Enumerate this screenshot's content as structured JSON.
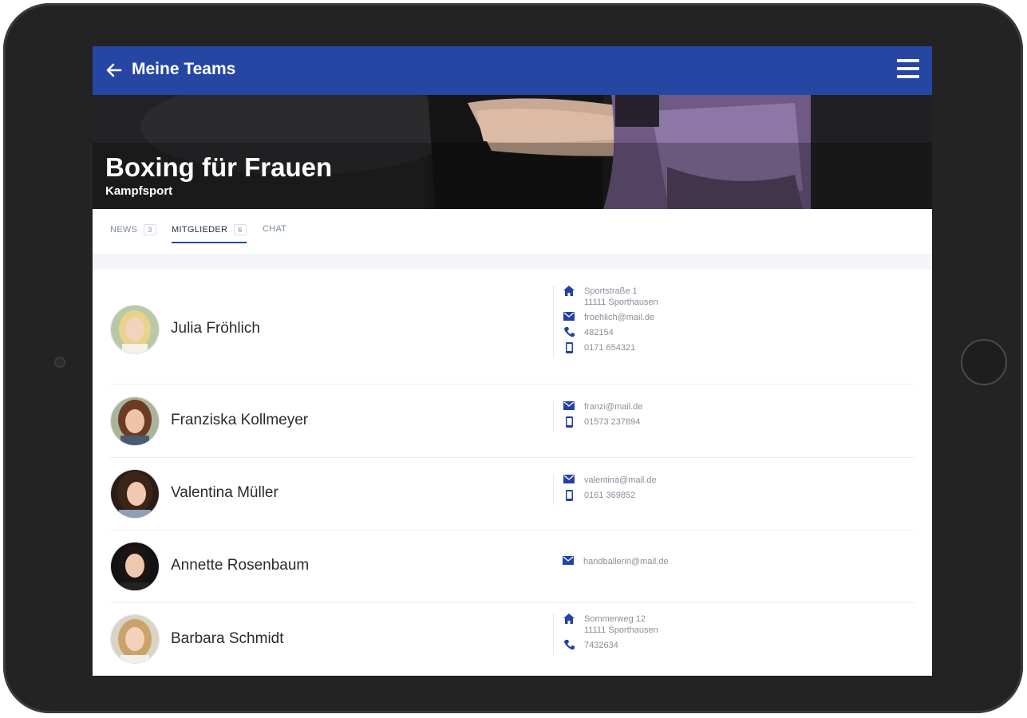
{
  "appbar": {
    "title": "Meine Teams",
    "back_icon": "arrow-left-icon",
    "menu_icon": "hamburger-menu-icon",
    "color": "#2646a3"
  },
  "hero": {
    "title": "Boxing für Frauen",
    "subtitle": "Kampfsport"
  },
  "tabs": [
    {
      "label": "NEWS",
      "count": "3",
      "active": false
    },
    {
      "label": "MITGLIEDER",
      "count": "6",
      "active": true
    },
    {
      "label": "CHAT",
      "count": "",
      "active": false
    }
  ],
  "members": [
    {
      "name": "Julia Fröhlich",
      "contacts": [
        {
          "icon": "home-icon",
          "lines": [
            "Sportstraße 1",
            "11111 Sporthausen"
          ]
        },
        {
          "icon": "mail-icon",
          "lines": [
            "froehlich@mail.de"
          ]
        },
        {
          "icon": "phone-icon",
          "lines": [
            "482154"
          ]
        },
        {
          "icon": "mobile-icon",
          "lines": [
            "0171 654321"
          ]
        }
      ]
    },
    {
      "name": "Franziska Kollmeyer",
      "contacts": [
        {
          "icon": "mail-icon",
          "lines": [
            "franzi@mail.de"
          ]
        },
        {
          "icon": "mobile-icon",
          "lines": [
            "01573 237894"
          ]
        }
      ]
    },
    {
      "name": "Valentina Müller",
      "contacts": [
        {
          "icon": "mail-icon",
          "lines": [
            "valentina@mail.de"
          ]
        },
        {
          "icon": "mobile-icon",
          "lines": [
            "0161 369852"
          ]
        }
      ]
    },
    {
      "name": "Annette Rosenbaum",
      "contacts": [
        {
          "icon": "mail-icon",
          "lines": [
            "handballerin@mail.de"
          ]
        }
      ]
    },
    {
      "name": "Barbara Schmidt",
      "contacts": [
        {
          "icon": "home-icon",
          "lines": [
            "Sommerweg 12",
            "11111 Sporthausen"
          ]
        },
        {
          "icon": "phone-icon",
          "lines": [
            "7432634"
          ]
        }
      ]
    }
  ],
  "colors": {
    "accent": "#2646a3",
    "icon": "#2341a8",
    "contact_text": "#8a8f98"
  }
}
